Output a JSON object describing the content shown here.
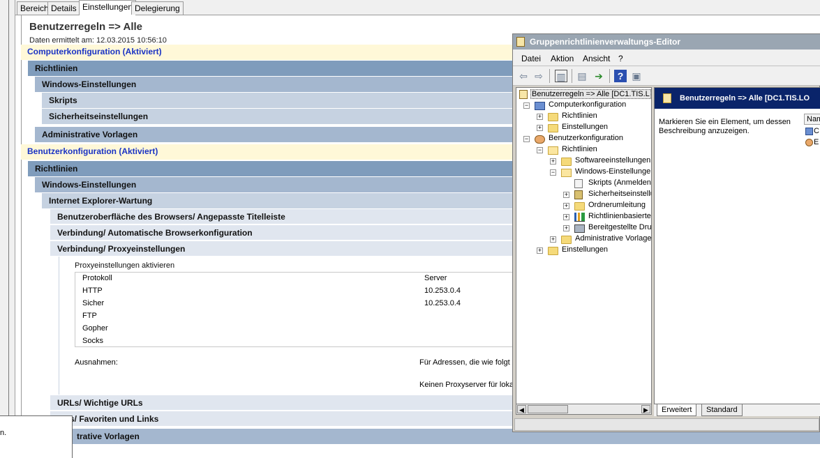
{
  "gpmc_tabs": [
    "Bereich",
    "Details",
    "Einstellungen",
    "Delegierung"
  ],
  "report": {
    "title": "Benutzerregeln => Alle",
    "date": "Daten ermittelt am: 12.03.2015 10:56:10",
    "computer_config": "Computerkonfiguration (Aktiviert)",
    "cc_richtlinien": "Richtlinien",
    "cc_windows": "Windows-Einstellungen",
    "cc_skripts": "Skripts",
    "cc_sicherheit": "Sicherheitseinstellungen",
    "cc_admin": "Administrative Vorlagen",
    "user_config": "Benutzerkonfiguration (Aktiviert)",
    "uc_richtlinien": "Richtlinien",
    "uc_windows": "Windows-Einstellungen",
    "uc_ie": "Internet Explorer-Wartung",
    "uc_browser_ui": "Benutzeroberfläche des Browsers/ Angepasste Titelleiste",
    "uc_auto_config": "Verbindung/ Automatische Browserkonfiguration",
    "uc_proxy": "Verbindung/ Proxyeinstellungen",
    "proxy_enable": "Proxyeinstellungen aktivieren",
    "proxy_table": {
      "col_protocol": "Protokoll",
      "col_server": "Server",
      "rows": [
        {
          "protocol": "HTTP",
          "server": "10.253.0.4"
        },
        {
          "protocol": "Sicher",
          "server": "10.253.0.4"
        },
        {
          "protocol": "FTP",
          "server": ""
        },
        {
          "protocol": "Gopher",
          "server": ""
        },
        {
          "protocol": "Socks",
          "server": ""
        }
      ]
    },
    "exceptions_label": "Ausnahmen:",
    "exceptions_text": "Für Adressen, die wie folgt b",
    "no_proxy_local": "Keinen Proxyserver für lokale",
    "uc_urls": "URLs/ Wichtige URLs",
    "uc_favorites": "s/ Favoriten und Links",
    "uc_admin": "trative Vorlagen",
    "popup_text": "n."
  },
  "editor": {
    "title": "Gruppenrichtlinienverwaltungs-Editor",
    "menu": [
      "Datei",
      "Aktion",
      "Ansicht",
      "?"
    ],
    "tree": [
      {
        "label": "Benutzerregeln => Alle [DC1.TIS.L",
        "icon": "gpo-doc-icon"
      },
      {
        "label": "Computerkonfiguration",
        "icon": "computer-icon"
      },
      {
        "label": "Richtlinien",
        "icon": "folder-icon"
      },
      {
        "label": "Einstellungen",
        "icon": "folder-icon"
      },
      {
        "label": "Benutzerkonfiguration",
        "icon": "user-icon"
      },
      {
        "label": "Richtlinien",
        "icon": "folder-icon"
      },
      {
        "label": "Softwareeinstellungen",
        "icon": "folder-icon"
      },
      {
        "label": "Windows-Einstellungen",
        "icon": "folder-icon"
      },
      {
        "label": "Skripts (Anmelden/",
        "icon": "script-icon"
      },
      {
        "label": "Sicherheitseinstellu",
        "icon": "security-icon"
      },
      {
        "label": "Ordnerumleitung",
        "icon": "folder-icon"
      },
      {
        "label": "Richtlinienbasierter",
        "icon": "chart-icon"
      },
      {
        "label": "Bereitgestellte Dru",
        "icon": "printer-icon"
      },
      {
        "label": "Administrative Vorlager",
        "icon": "folder-icon"
      },
      {
        "label": "Einstellungen",
        "icon": "folder-icon"
      }
    ],
    "right_header": "Benutzerregeln => Alle [DC1.TIS.LO",
    "right_desc": "Markieren Sie ein Element, um dessen Beschreibung anzuzeigen.",
    "col_name": "Nam",
    "items": [
      "C",
      "E"
    ],
    "tab_extended": "Erweitert",
    "tab_standard": "Standard"
  }
}
